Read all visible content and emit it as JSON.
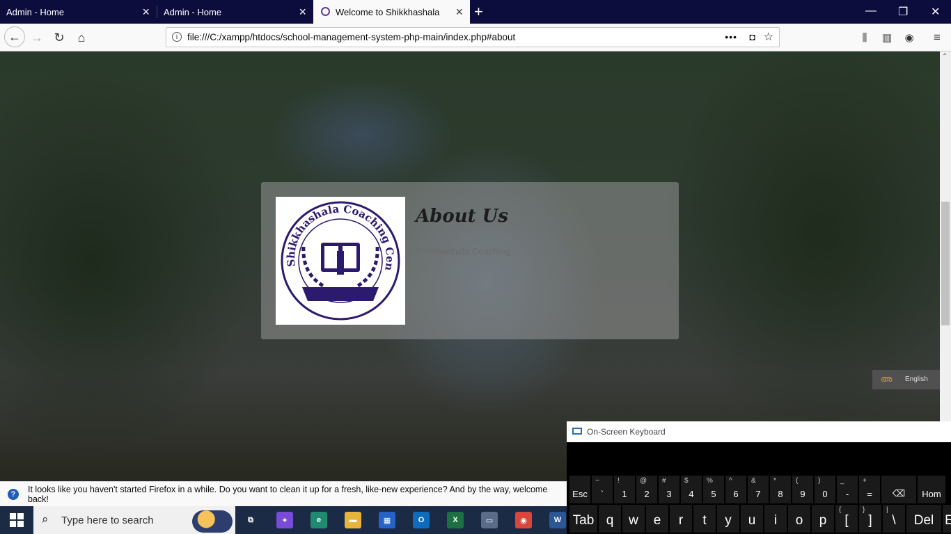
{
  "tabs": [
    {
      "title": "Admin - Home",
      "active": false
    },
    {
      "title": "Admin - Home",
      "active": false
    },
    {
      "title": "Welcome to Shikkhashala",
      "active": true
    }
  ],
  "window_controls": {
    "minimize": "—",
    "restore": "❐",
    "close": "✕"
  },
  "address_bar": {
    "url": "file:///C:/xampp/htdocs/school-management-system-php-main/index.php#about"
  },
  "about": {
    "heading": "About Us",
    "text": "Shikkhashala Coaching",
    "logo_text": "Shikkhashala Coaching Centre"
  },
  "language_widget": {
    "label": "English"
  },
  "notification": {
    "text": "It looks like you haven't started Firefox in a while. Do you want to clean it up for a fresh, like-new experience? And by the way, welcome back!"
  },
  "osk": {
    "title": "On-Screen Keyboard",
    "row1": [
      {
        "main": "Esc",
        "top": ""
      },
      {
        "main": "`",
        "top": "~"
      },
      {
        "main": "1",
        "top": "!"
      },
      {
        "main": "2",
        "top": "@"
      },
      {
        "main": "3",
        "top": "#"
      },
      {
        "main": "4",
        "top": "$"
      },
      {
        "main": "5",
        "top": "%"
      },
      {
        "main": "6",
        "top": "^"
      },
      {
        "main": "7",
        "top": "&"
      },
      {
        "main": "8",
        "top": "*"
      },
      {
        "main": "9",
        "top": "("
      },
      {
        "main": "0",
        "top": ")"
      },
      {
        "main": "-",
        "top": "_"
      },
      {
        "main": "=",
        "top": "+"
      },
      {
        "main": "⌫",
        "top": ""
      },
      {
        "main": "Hom",
        "top": ""
      }
    ],
    "row2": [
      {
        "main": "Tab",
        "top": ""
      },
      {
        "main": "q",
        "top": ""
      },
      {
        "main": "w",
        "top": ""
      },
      {
        "main": "e",
        "top": ""
      },
      {
        "main": "r",
        "top": ""
      },
      {
        "main": "t",
        "top": ""
      },
      {
        "main": "y",
        "top": ""
      },
      {
        "main": "u",
        "top": ""
      },
      {
        "main": "i",
        "top": ""
      },
      {
        "main": "o",
        "top": ""
      },
      {
        "main": "p",
        "top": ""
      },
      {
        "main": "[",
        "top": "{"
      },
      {
        "main": "]",
        "top": "}"
      },
      {
        "main": "\\",
        "top": "|"
      },
      {
        "main": "Del",
        "top": ""
      },
      {
        "main": "End",
        "top": ""
      }
    ]
  },
  "taskbar": {
    "search_placeholder": "Type here to search",
    "apps": [
      {
        "name": "task-view",
        "glyph": "⧉",
        "color": "#1b2a45"
      },
      {
        "name": "copilot",
        "glyph": "✦",
        "color": "#7a4ad8"
      },
      {
        "name": "edge",
        "glyph": "e",
        "color": "#1f8a70"
      },
      {
        "name": "file-explorer",
        "glyph": "▬",
        "color": "#e8b43a"
      },
      {
        "name": "store",
        "glyph": "▦",
        "color": "#2563c9"
      },
      {
        "name": "outlook",
        "glyph": "O",
        "color": "#0f6cbd"
      },
      {
        "name": "excel",
        "glyph": "X",
        "color": "#1d7044"
      },
      {
        "name": "network",
        "glyph": "▭",
        "color": "#5b6b8a"
      },
      {
        "name": "chrome",
        "glyph": "◉",
        "color": "#d9463b"
      },
      {
        "name": "word",
        "glyph": "W",
        "color": "#2b5797"
      }
    ]
  }
}
